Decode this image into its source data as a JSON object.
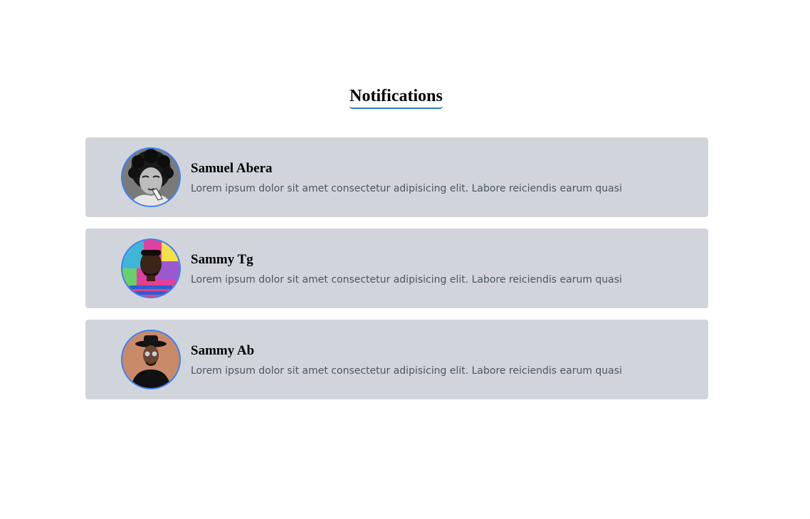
{
  "header": {
    "title": "Notifications",
    "underline_color": "#2f7fb8"
  },
  "notifications": [
    {
      "name": "Samuel Abera",
      "message": "Lorem ipsum dolor sit amet consectetur adipisicing elit. Labore reiciendis earum quasi",
      "avatar": "avatar-photo-curly-hair-bw"
    },
    {
      "name": "Sammy Tg",
      "message": "Lorem ipsum dolor sit amet consectetur adipisicing elit. Labore reiciendis earum quasi",
      "avatar": "avatar-photo-colorful-background"
    },
    {
      "name": "Sammy Ab",
      "message": "Lorem ipsum dolor sit amet consectetur adipisicing elit. Labore reiciendis earum quasi",
      "avatar": "avatar-photo-hat-sunglasses"
    }
  ],
  "colors": {
    "card_background": "#d1d5db",
    "avatar_border": "#3b82f6",
    "message_text": "#4b5563"
  }
}
